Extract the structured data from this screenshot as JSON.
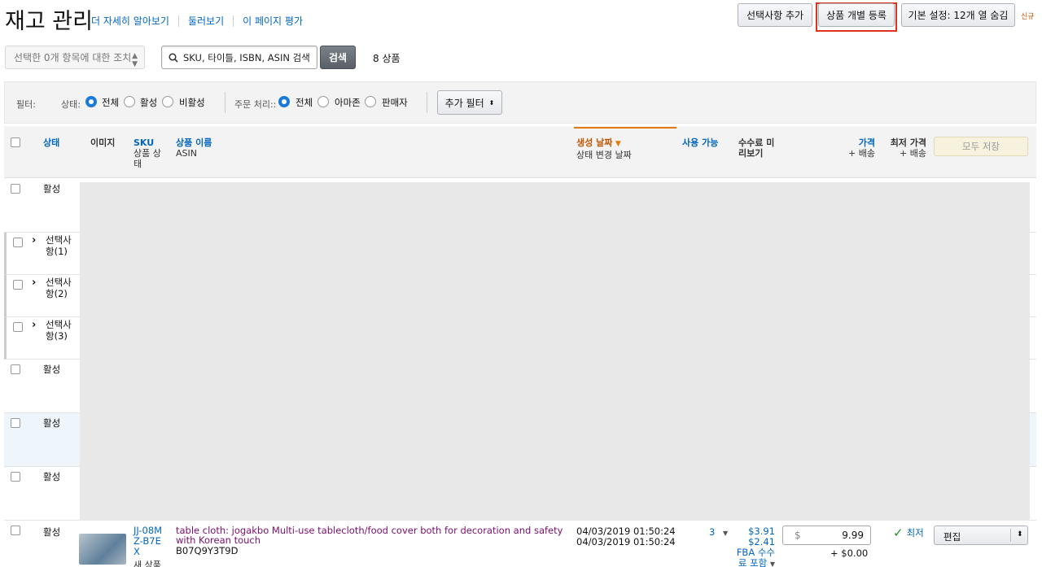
{
  "header": {
    "title": "재고 관리",
    "links": [
      "더 자세히 알아보기",
      "둘러보기",
      "이 페이지 평가"
    ],
    "add_variation_label": "선택사항 추가",
    "add_product_label": "상품 개별 등록",
    "preferences_label": "기본 설정: 12개 열 숨김",
    "new_badge": "신규"
  },
  "toolbar": {
    "bulk_action_placeholder": "선택한 0개 항목에 대한 조치",
    "search_placeholder": "SKU, 타이틀, ISBN, ASIN 검색",
    "search_button": "검색",
    "result_count": "8 상품"
  },
  "filters": {
    "label": "필터:",
    "status_label": "상태:",
    "status_options": [
      "전체",
      "활성",
      "비활성"
    ],
    "status_selected": "전체",
    "fulfillment_label": "주문 처리::",
    "fulfillment_options": [
      "전체",
      "아마존",
      "판매자"
    ],
    "fulfillment_selected": "전체",
    "more_filters": "추가 필터"
  },
  "table": {
    "columns": {
      "status": "상태",
      "image": "이미지",
      "sku": "SKU",
      "sku_sub": "상품 상태",
      "product_name": "상품 이름",
      "product_name_sub": "ASIN",
      "date_created": "생성 날짜",
      "date_sub": "상태 변경 날짜",
      "available": "사용 가능",
      "fee_preview": "수수료 미리보기",
      "price": "가격",
      "price_sub": "+ 배송",
      "lowest_price": "최저 가격",
      "lowest_price_sub": "+ 배송",
      "save_all": "모두 저장"
    },
    "rows": [
      {
        "type": "status",
        "status": "활성"
      },
      {
        "type": "variation",
        "label": "선택사항(1)"
      },
      {
        "type": "variation",
        "label": "선택사항(2)"
      },
      {
        "type": "variation",
        "label": "선택사항(3)"
      },
      {
        "type": "status",
        "status": "활성"
      },
      {
        "type": "status",
        "status": "활성"
      },
      {
        "type": "status",
        "status": "활성"
      }
    ],
    "product": {
      "status": "활성",
      "sku": "JJ-08MZ-B7EX",
      "condition": "새 상품",
      "name": "table cloth: jogakbo Multi-use tablecloth/food cover both for decoration and safety with Korean touch",
      "asin": "B07Q9Y3T9D",
      "date_created": "04/03/2019 01:50:24",
      "date_status_changed": "04/03/2019 01:50:24",
      "available": "3",
      "fee_1": "$3.91",
      "fee_2": "$2.41",
      "fee_note": "FBA 수수료 포함",
      "currency": "$",
      "price": "9.99",
      "shipping": "+ $0.00",
      "lowest_label": "최저",
      "edit_label": "편집"
    }
  }
}
